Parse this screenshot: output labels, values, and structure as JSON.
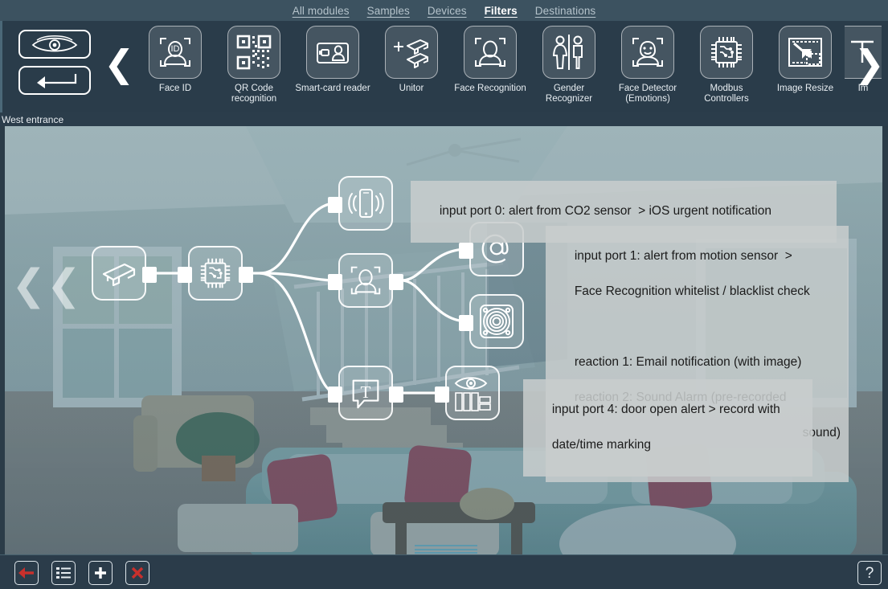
{
  "topnav": {
    "links": [
      {
        "label": "All modules",
        "active": false
      },
      {
        "label": "Samples",
        "active": false
      },
      {
        "label": "Devices",
        "active": false
      },
      {
        "label": "Filters",
        "active": true
      },
      {
        "label": "Destinations",
        "active": false
      }
    ]
  },
  "toolbar": {
    "preview_button": "eye-icon",
    "back_button": "arrow-left-icon",
    "prev_arrow": "❮",
    "next_arrow": "❯",
    "modules": [
      {
        "label": "Face ID",
        "icon": "face-id-icon"
      },
      {
        "label": "QR Code\nrecognition",
        "icon": "qr-code-icon"
      },
      {
        "label": "Smart-card\nreader",
        "icon": "smart-card-icon"
      },
      {
        "label": "Unitor",
        "icon": "unitor-cameras-icon"
      },
      {
        "label": "Face Recognition",
        "icon": "face-recognition-icon"
      },
      {
        "label": "Gender\nRecognizer",
        "icon": "gender-icon"
      },
      {
        "label": "Face Detector\n(Emotions)",
        "icon": "face-emotion-icon"
      },
      {
        "label": "Modbus\nControllers",
        "icon": "chip-icon"
      },
      {
        "label": "Image Resize",
        "icon": "image-resize-icon"
      },
      {
        "label": "Im",
        "icon": "clipped-icon"
      }
    ]
  },
  "scene": {
    "label": "West entrance",
    "left_scroll": "❮❮"
  },
  "graph": {
    "nodes": [
      {
        "id": "camera",
        "name": "camera-node",
        "icon": "cctv-camera-icon"
      },
      {
        "id": "chip",
        "name": "controller-node",
        "icon": "chip-icon"
      },
      {
        "id": "phone",
        "name": "mobile-notification-node",
        "icon": "phone-ringing-icon"
      },
      {
        "id": "face",
        "name": "face-recognition-node",
        "icon": "face-recognition-icon"
      },
      {
        "id": "email",
        "name": "email-node",
        "icon": "at-sign-icon"
      },
      {
        "id": "siren",
        "name": "sound-alarm-node",
        "icon": "speaker-siren-icon"
      },
      {
        "id": "text",
        "name": "text-overlay-node",
        "icon": "text-bubble-icon"
      },
      {
        "id": "recorder",
        "name": "recorder-node",
        "icon": "eye-monitors-icon"
      }
    ],
    "annotations": [
      {
        "id": "ann0",
        "text": "input port 0: alert from CO2 sensor  > iOS urgent notification"
      },
      {
        "id": "ann1",
        "line1": "input port 1: alert from motion sensor  >",
        "line2": "Face Recognition whitelist / blacklist check",
        "line3": "",
        "line4": "reaction 1: Email notification (with image)",
        "line5": "reaction 2: Sound Alarm (pre-recorded",
        "line6": "sound)"
      },
      {
        "id": "ann4",
        "line1": "input port 4: door open alert > record with",
        "line2": "date/time marking"
      }
    ]
  },
  "bottombar": {
    "buttons": [
      {
        "label": "back-button",
        "icon": "arrow-left-icon",
        "color": "#c9302c"
      },
      {
        "label": "list-button",
        "icon": "list-icon",
        "color": "#ffffff"
      },
      {
        "label": "add-button",
        "icon": "plus-icon",
        "color": "#ffffff"
      },
      {
        "label": "delete-button",
        "icon": "cross-icon",
        "color": "#c9302c"
      }
    ],
    "help_label": "?"
  },
  "colors": {
    "header_bg": "#3c5260",
    "strip_bg": "#2a3c4a",
    "accent_red": "#c9302c",
    "text_light": "#e8eef2"
  }
}
